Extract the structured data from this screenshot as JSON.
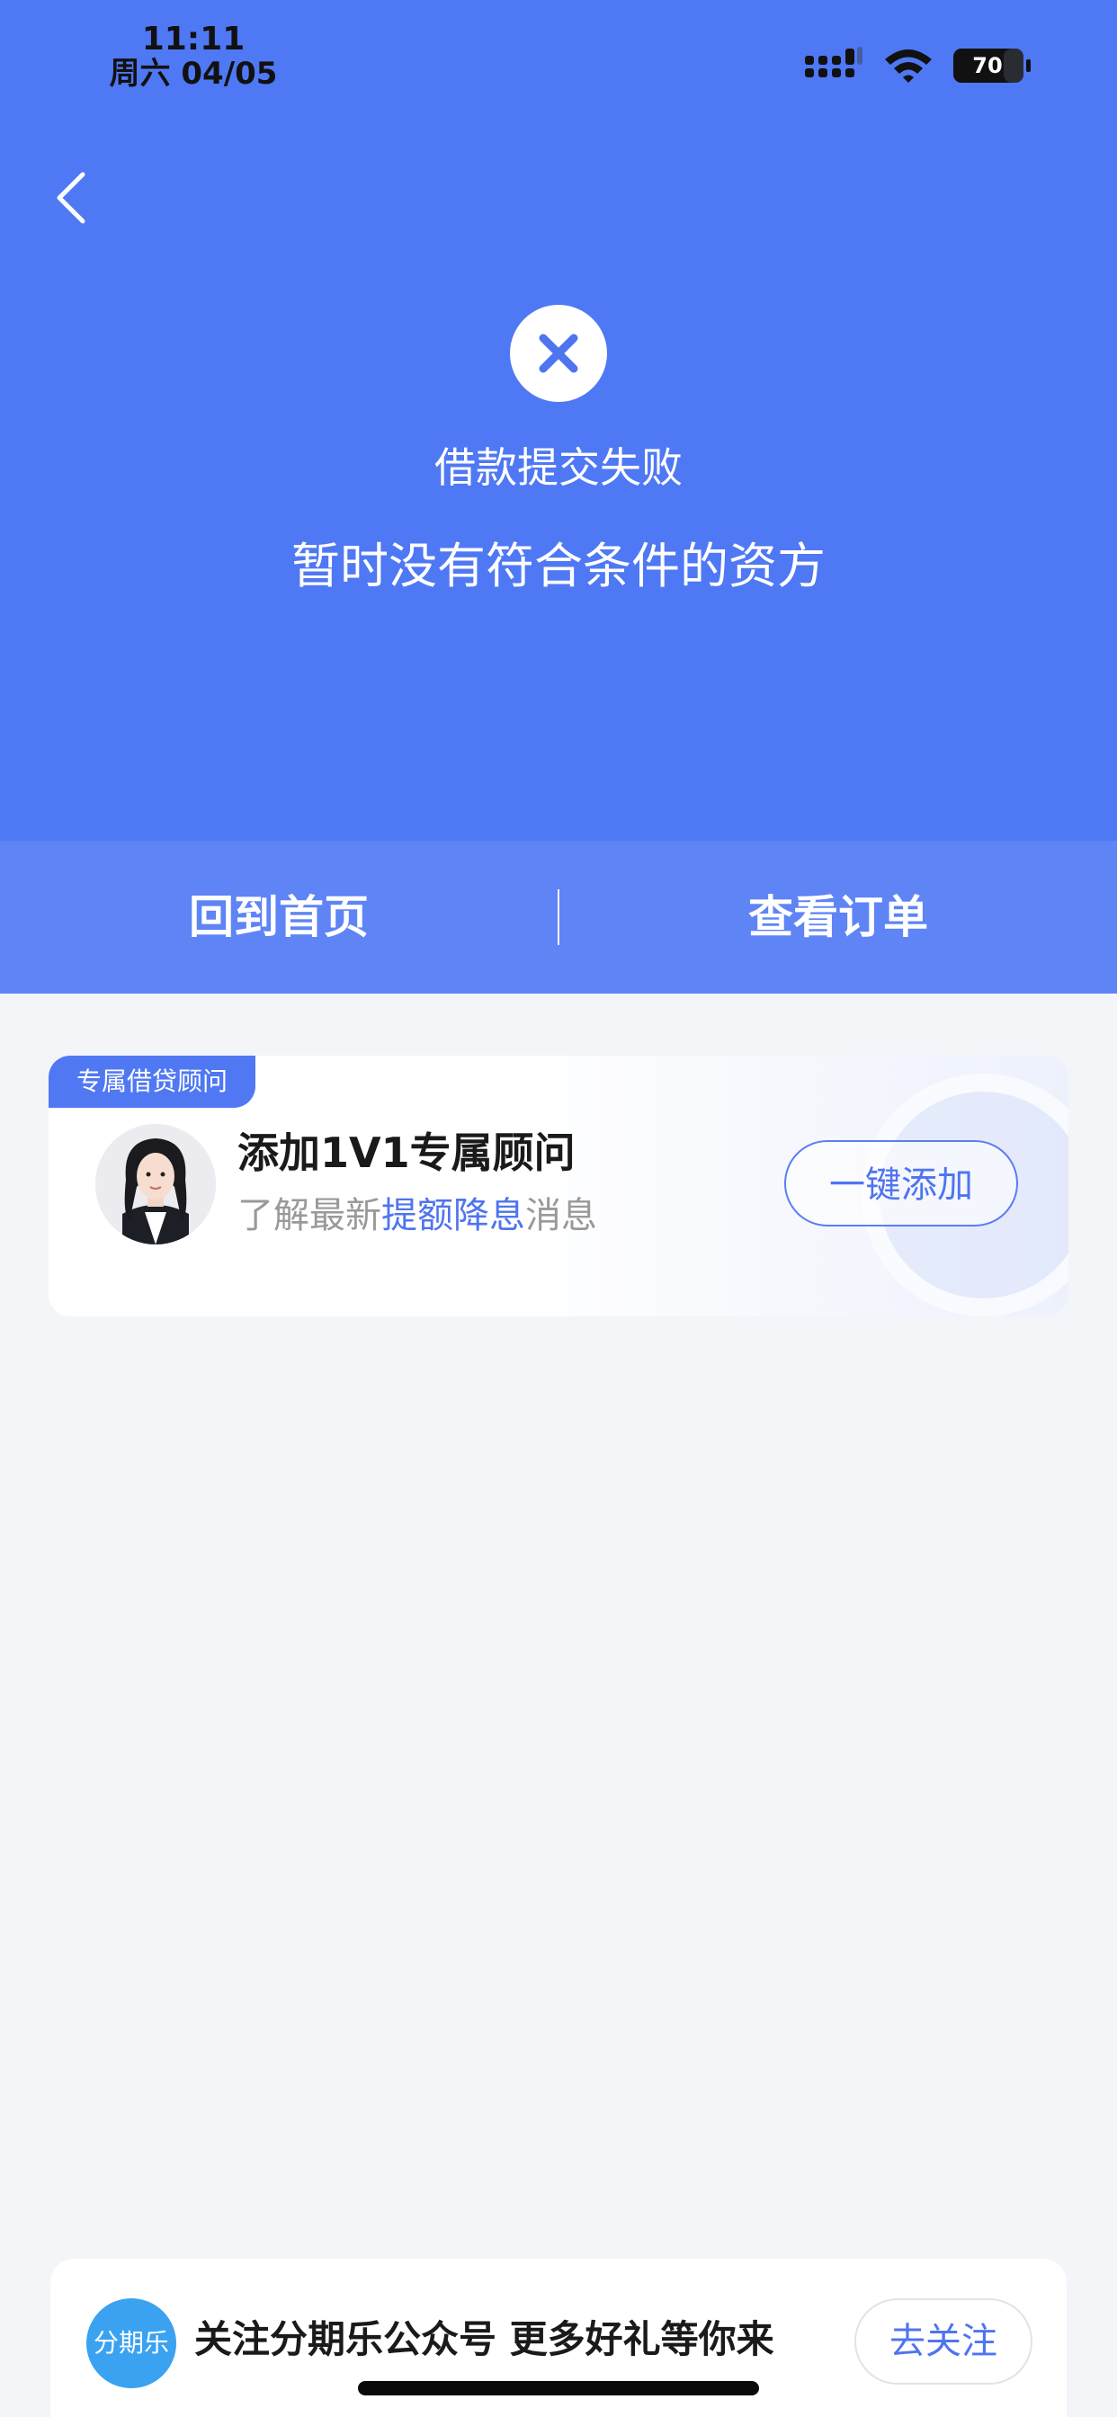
{
  "status_bar": {
    "time": "11:11",
    "date": "周六 04/05",
    "battery": "70",
    "icons": [
      "signal-icon",
      "wifi-icon",
      "battery-icon"
    ]
  },
  "result": {
    "title": "借款提交失败",
    "subtitle": "暂时没有符合条件的资方",
    "icon": "close-circle-icon"
  },
  "actions": {
    "home_label": "回到首页",
    "orders_label": "查看订单"
  },
  "advisor_card": {
    "tag": "专属借贷顾问",
    "title": "添加1V1专属顾问",
    "desc_prefix": "了解最新",
    "desc_highlight": "提额降息",
    "desc_suffix": "消息",
    "button_label": "一键添加"
  },
  "follow_banner": {
    "logo_text": "分期乐",
    "text": "关注分期乐公众号 更多好礼等你来",
    "button_label": "去关注"
  },
  "colors": {
    "hero_bg": "#4f78f4",
    "action_bar_bg": "#5e84f5",
    "accent": "#4f74f0",
    "page_bg": "#f4f5f8"
  }
}
